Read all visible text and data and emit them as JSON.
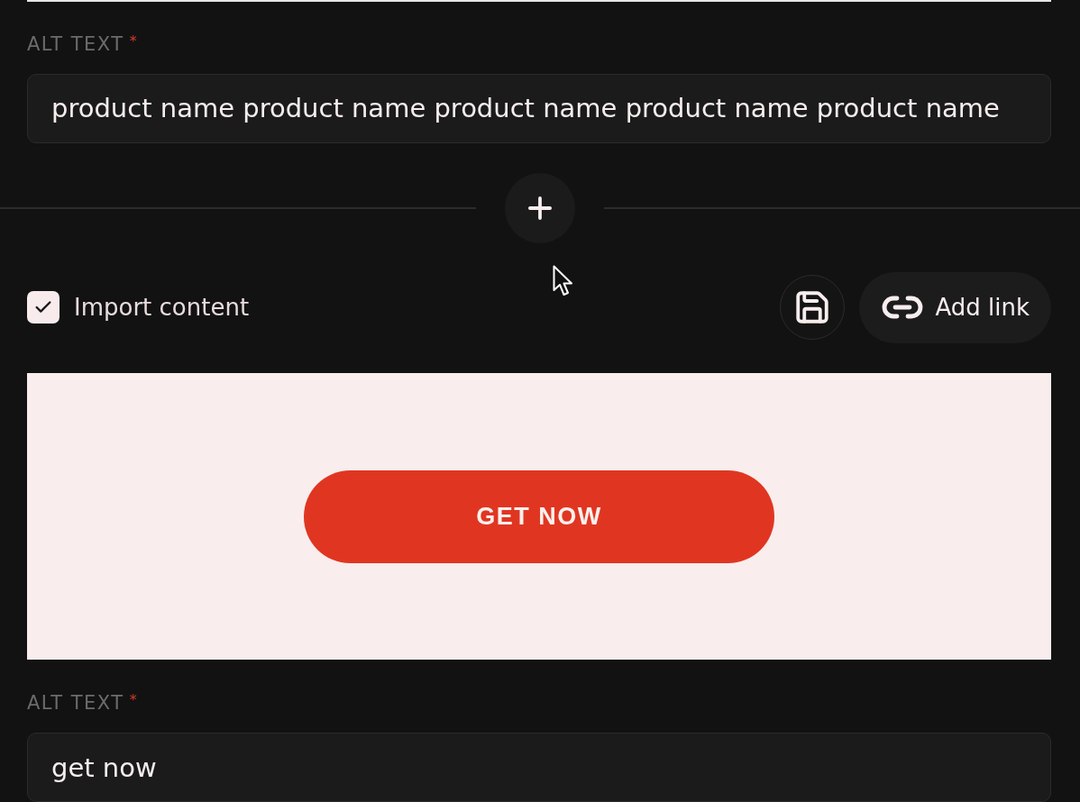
{
  "image_alt": {
    "label": "ALT TEXT",
    "required_mark": "*",
    "value": "product name product name product name product name product name"
  },
  "import_content": {
    "label": "Import content",
    "checked": true
  },
  "add_link_button": {
    "label": "Add link"
  },
  "preview": {
    "button_label": "GET NOW"
  },
  "button_alt": {
    "label": "ALT TEXT",
    "required_mark": "*",
    "value": "get now"
  }
}
